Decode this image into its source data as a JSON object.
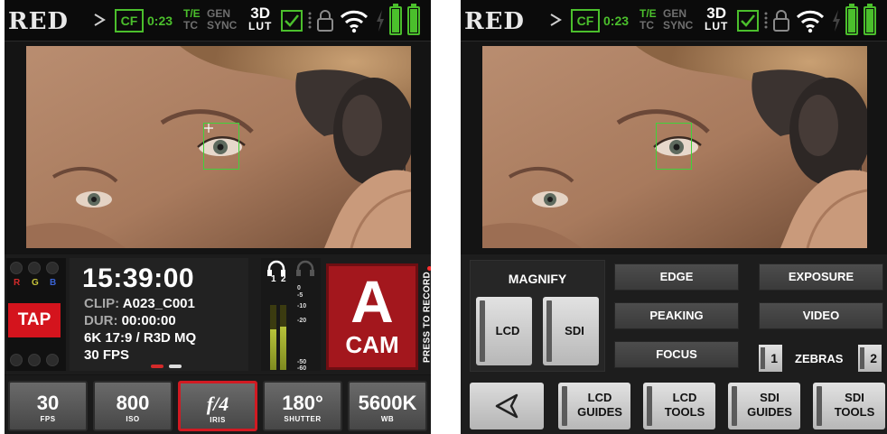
{
  "status_bar": {
    "logo": "RED",
    "media_label": "CF",
    "media_time": "0:23",
    "te_label": "T/E",
    "tc_label": "TC",
    "gen_label": "GEN",
    "sync_label": "SYNC",
    "lut_top": "3D",
    "lut_bottom": "LUT",
    "colors": {
      "green": "#4bbf2c",
      "dim": "#6f6f6f"
    }
  },
  "left_screen": {
    "tap_label": "TAP",
    "meter_channels": [
      "R",
      "G",
      "B"
    ],
    "timecode": "15:39:00",
    "clip_key": "CLIP:",
    "clip_value": "A023_C001",
    "dur_key": "DUR:",
    "dur_value": "00:00:00",
    "format": "6K 17:9 / R3D MQ",
    "fps_line": "30 FPS",
    "audio_channels": [
      "1",
      "2"
    ],
    "audio_scale": [
      "0",
      "-5",
      "-10",
      "-20",
      "-50",
      "-60"
    ],
    "audio_levels": [
      0.62,
      0.66
    ],
    "record_letter": "A",
    "record_cam": "CAM",
    "press_to_record": "PRESS TO RECORD",
    "params": [
      {
        "value": "30",
        "label": "FPS"
      },
      {
        "value": "800",
        "label": "ISO"
      },
      {
        "value": "f/4",
        "label": "IRIS"
      },
      {
        "value": "180°",
        "label": "SHUTTER"
      },
      {
        "value": "5600K",
        "label": "WB"
      }
    ],
    "active_param": "IRIS",
    "accent_red": "#d11a22"
  },
  "right_screen": {
    "magnify_title": "MAGNIFY",
    "magnify_lcd": "LCD",
    "magnify_sdi": "SDI",
    "edge": "EDGE",
    "peaking": "PEAKING",
    "focus": "FOCUS",
    "exposure": "EXPOSURE",
    "video": "VIDEO",
    "zebra_1": "1",
    "zebras": "ZEBRAS",
    "zebra_2": "2",
    "tools": [
      {
        "top": "LCD",
        "bottom": "GUIDES"
      },
      {
        "top": "LCD",
        "bottom": "TOOLS"
      },
      {
        "top": "SDI",
        "bottom": "GUIDES"
      },
      {
        "top": "SDI",
        "bottom": "TOOLS"
      }
    ]
  }
}
